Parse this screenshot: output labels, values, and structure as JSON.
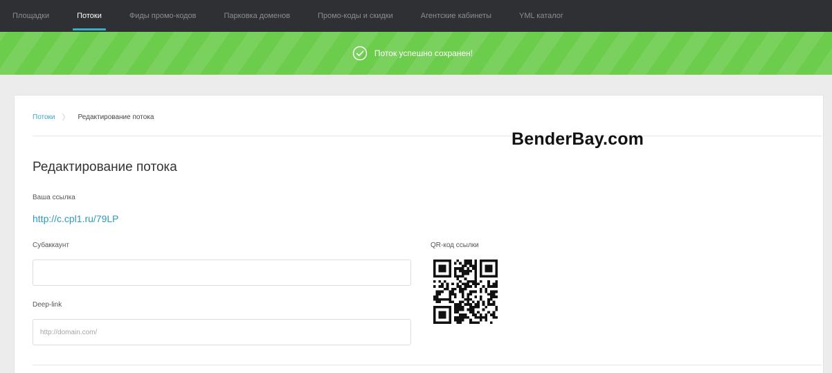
{
  "topnav": {
    "items": [
      {
        "label": "Площадки",
        "active": false
      },
      {
        "label": "Потоки",
        "active": true
      },
      {
        "label": "Фиды промо-кодов",
        "active": false
      },
      {
        "label": "Парковка доменов",
        "active": false
      },
      {
        "label": "Промо-коды и скидки",
        "active": false
      },
      {
        "label": "Агентские кабинеты",
        "active": false
      },
      {
        "label": "YML каталог",
        "active": false
      }
    ]
  },
  "banner": {
    "message": "Поток успешно сохранен!",
    "icon": "check-circle-icon",
    "color": "#6ccc4c"
  },
  "breadcrumb": {
    "parent": "Потоки",
    "separator": "〉",
    "current": "Редактирование потока"
  },
  "watermark": "BenderBay.com",
  "form": {
    "title": "Редактирование потока",
    "link_label": "Ваша ссылка",
    "link_url": "http://c.cpl1.ru/79LP",
    "subaccount_label": "Субаккаунт",
    "subaccount_value": "",
    "deeplink_label": "Deep-link",
    "deeplink_placeholder": "http://domain.com/",
    "qr_label": "QR-код ссылки"
  },
  "colors": {
    "accent": "#2db6c9",
    "link": "#2c98bd",
    "nav_bg": "#2f3033"
  }
}
